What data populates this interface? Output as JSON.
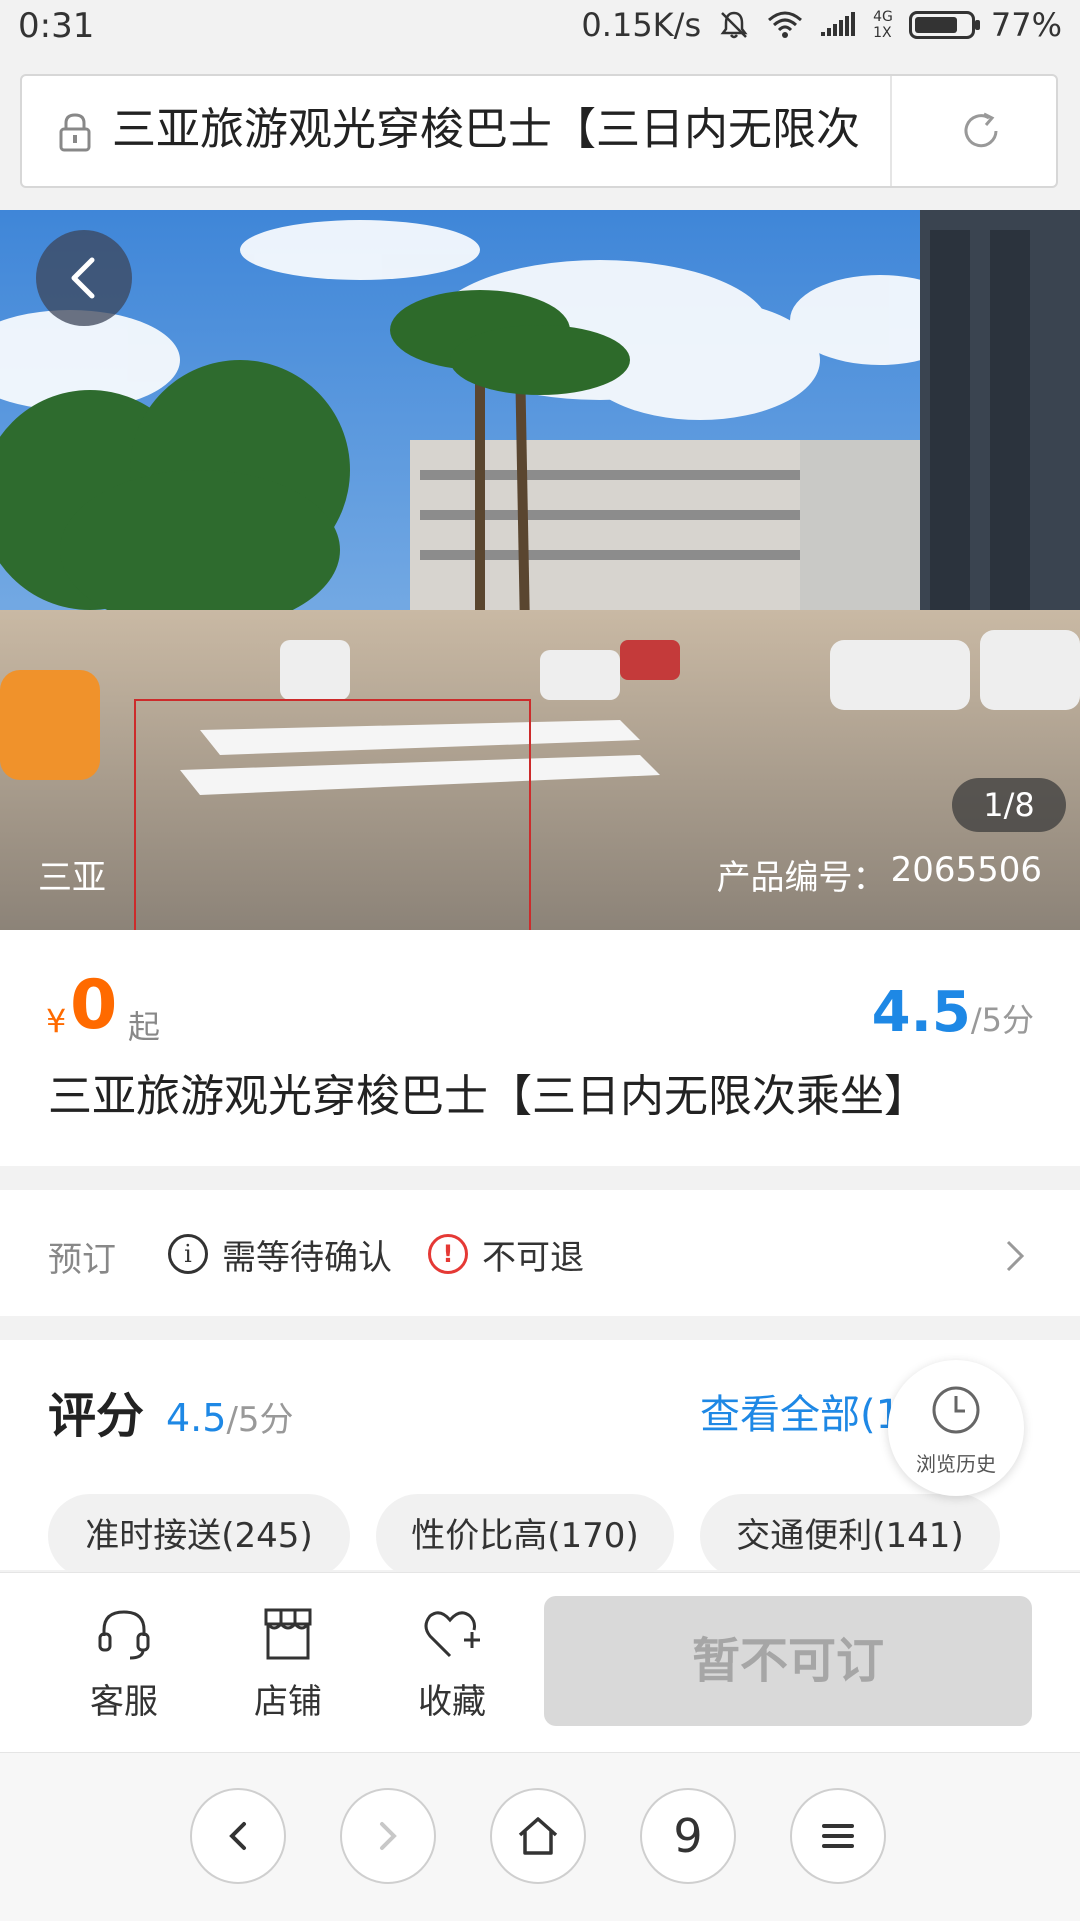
{
  "status_bar": {
    "time": "0:31",
    "network_speed": "0.15K/s",
    "net_type_top": "4G",
    "net_type_bottom": "1X",
    "battery": "77%",
    "battery_level": 0.77
  },
  "address_bar": {
    "url_title": "三亚旅游观光穿梭巴士【三日内无限次"
  },
  "hero": {
    "counter": "1/8",
    "city": "三亚",
    "product_code_label": "产品编号：",
    "product_code": "2065506"
  },
  "price": {
    "currency": "¥",
    "value": "0",
    "suffix": "起",
    "rating": "4.5",
    "rating_max": "/5分"
  },
  "product_title": "三亚旅游观光穿梭巴士【三日内无限次乘坐】",
  "booking": {
    "label": "预订",
    "tags": [
      "需等待确认",
      "不可退"
    ]
  },
  "reviews": {
    "title": "评分",
    "score": "4.5",
    "score_max": "/5分",
    "see_all": "查看全部(1",
    "chips": [
      "准时接送(245)",
      "性价比高(170)",
      "交通便利(141)"
    ],
    "history_label": "浏览历史"
  },
  "actions": {
    "service": "客服",
    "shop": "店铺",
    "favorite": "收藏",
    "book_button": "暂不可订"
  },
  "browser_nav": {
    "tab_count": "9"
  },
  "colors": {
    "accent_orange": "#ff6a00",
    "accent_blue": "#1e88e5",
    "disabled_bg": "#d9d9d9"
  }
}
